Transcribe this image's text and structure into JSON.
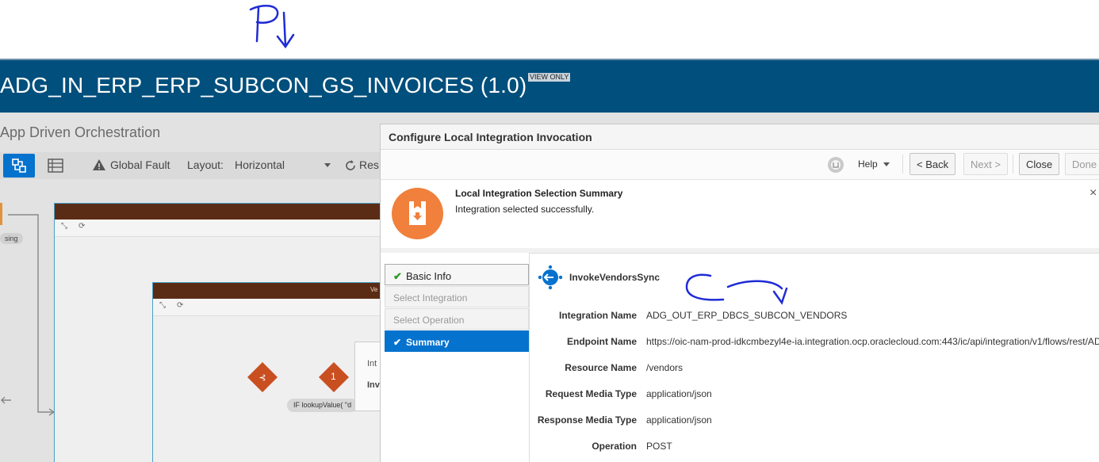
{
  "page": {
    "title": "ADG_IN_ERP_ERP_SUBCON_GS_INVOICES (1.0)",
    "badge": "VIEW ONLY",
    "subtitle": "App Driven Orchestration"
  },
  "toolbar": {
    "global_fault": "Global Fault",
    "layout_label": "Layout:",
    "layout_value": "Horizontal",
    "reset_partial": "Res"
  },
  "canvas": {
    "left_label": "sing",
    "condition_label": "IF lookupValue( \"d",
    "node_number": "1",
    "node_orange_label": "Ve",
    "popup_line1": "Int",
    "popup_line2": "Inv"
  },
  "dialog": {
    "title": "Configure Local Integration Invocation",
    "help": "Help",
    "back": "< Back",
    "next": "Next >",
    "close": "Close",
    "done": "Done",
    "message_title": "Local Integration Selection Summary",
    "message_text": "Integration selected successfully.",
    "message_close": "×"
  },
  "train": {
    "steps": [
      {
        "label": "Basic Info",
        "state": "done"
      },
      {
        "label": "Select Integration",
        "state": "disabled"
      },
      {
        "label": "Select Operation",
        "state": "disabled"
      },
      {
        "label": "Summary",
        "state": "active"
      }
    ]
  },
  "summary": {
    "invoke_name": "InvokeVendorsSync",
    "properties": [
      {
        "label": "Integration Name",
        "value": "ADG_OUT_ERP_DBCS_SUBCON_VENDORS"
      },
      {
        "label": "Endpoint Name",
        "value": "https://oic-nam-prod-idkcmbezyl4e-ia.integration.ocp.oraclecloud.com:443/ic/api/integration/v1/flows/rest/AD"
      },
      {
        "label": "Resource Name",
        "value": "/vendors"
      },
      {
        "label": "Request Media Type",
        "value": "application/json"
      },
      {
        "label": "Response Media Type",
        "value": "application/json"
      },
      {
        "label": "Operation",
        "value": "POST"
      }
    ]
  },
  "colors": {
    "header": "#004f7c",
    "accent": "#0572ce",
    "success_icon": "#f0803c",
    "scope_header": "#5b2c15",
    "node": "#c94f21",
    "ink": "#1f2bd6"
  }
}
